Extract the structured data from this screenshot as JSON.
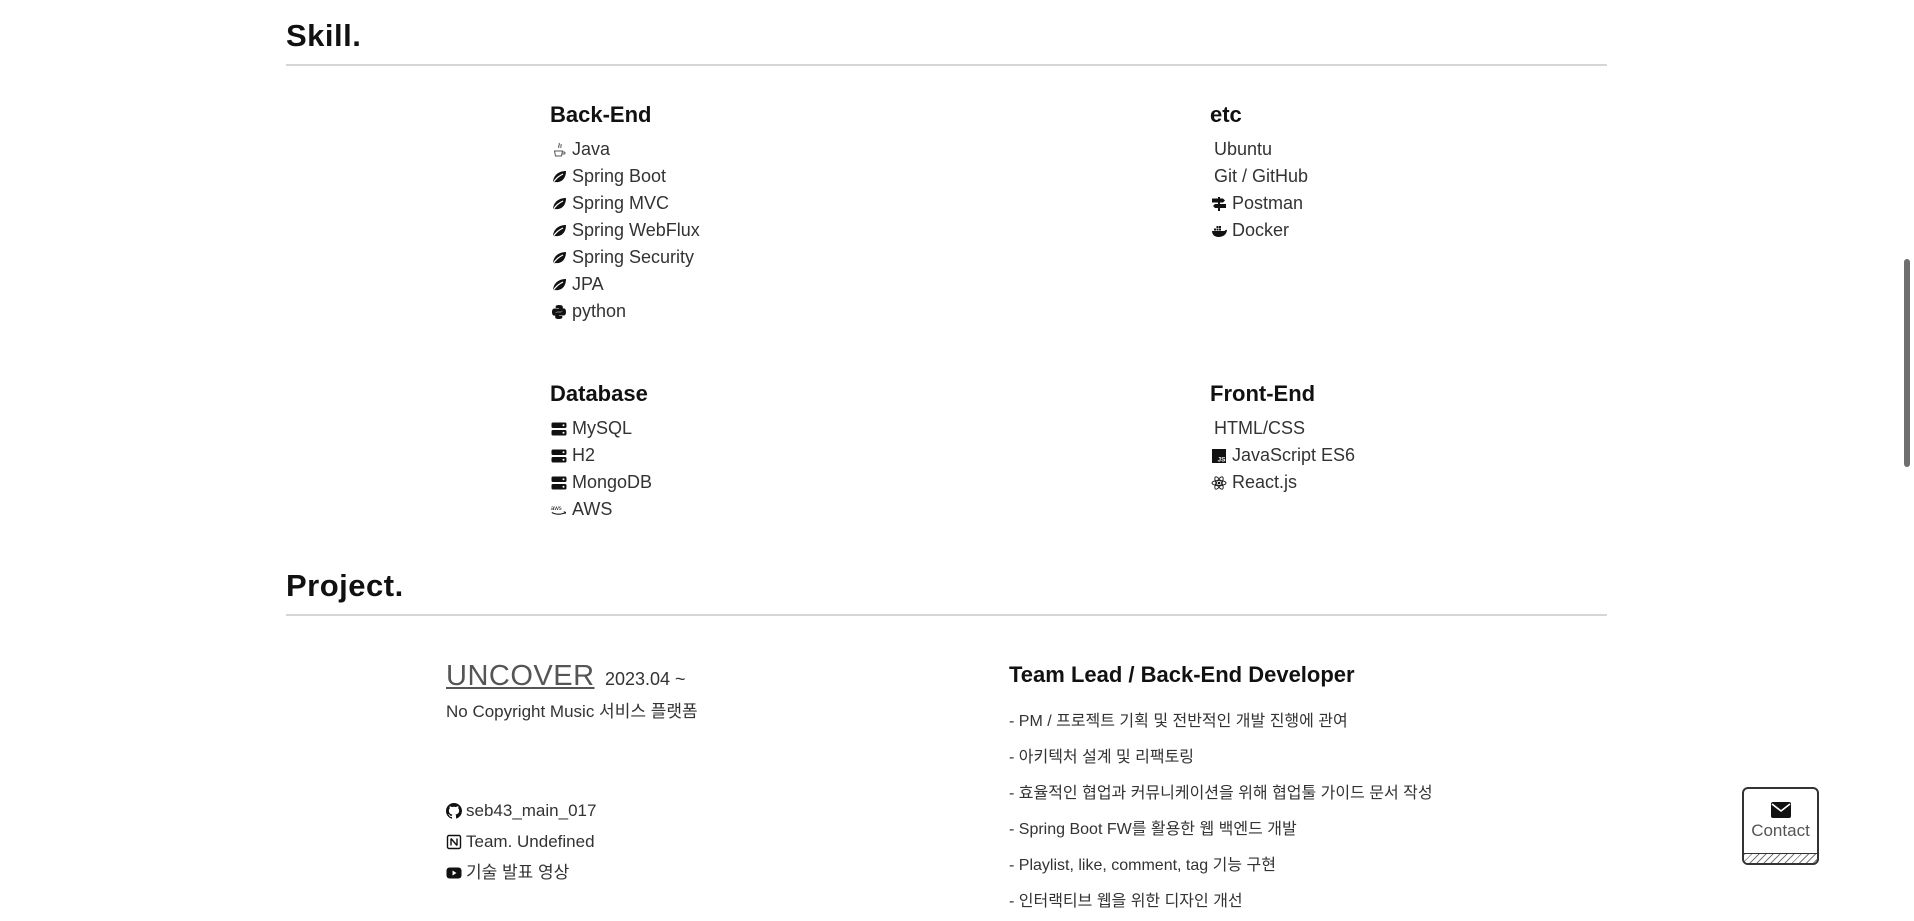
{
  "skill_section": {
    "title": "Skill.",
    "groups": [
      {
        "heading": "Back-End",
        "items": [
          {
            "label": "Java",
            "icon": "java-icon"
          },
          {
            "label": "Spring Boot",
            "icon": "leaf-icon"
          },
          {
            "label": "Spring MVC",
            "icon": "leaf-icon"
          },
          {
            "label": "Spring WebFlux",
            "icon": "leaf-icon"
          },
          {
            "label": "Spring Security",
            "icon": "leaf-icon"
          },
          {
            "label": "JPA",
            "icon": "leaf-icon"
          },
          {
            "label": "python",
            "icon": "python-icon"
          }
        ]
      },
      {
        "heading": "etc",
        "items": [
          {
            "label": "Ubuntu",
            "icon": "none"
          },
          {
            "label": "Git / GitHub",
            "icon": "none"
          },
          {
            "label": "Postman",
            "icon": "signpost-icon"
          },
          {
            "label": "Docker",
            "icon": "docker-icon"
          }
        ]
      },
      {
        "heading": "Database",
        "items": [
          {
            "label": "MySQL",
            "icon": "server-icon"
          },
          {
            "label": "H2",
            "icon": "server-icon"
          },
          {
            "label": "MongoDB",
            "icon": "server-icon"
          },
          {
            "label": "AWS",
            "icon": "aws-icon"
          }
        ]
      },
      {
        "heading": "Front-End",
        "items": [
          {
            "label": "HTML/CSS",
            "icon": "none"
          },
          {
            "label": "JavaScript ES6",
            "icon": "js-icon"
          },
          {
            "label": "React.js",
            "icon": "react-icon"
          }
        ]
      }
    ]
  },
  "project_section": {
    "title": "Project.",
    "project": {
      "name": "UNCOVER",
      "date": "2023.04 ~",
      "description": "No Copyright Music 서비스 플랫폼",
      "links": [
        {
          "label": "seb43_main_017",
          "icon": "github-icon"
        },
        {
          "label": "Team. Undefined",
          "icon": "notion-icon"
        },
        {
          "label": "기술 발표 영상",
          "icon": "youtube-icon"
        }
      ],
      "role": "Team Lead / Back-End Developer",
      "tasks": [
        "- PM / 프로젝트 기획 및 전반적인 개발 진행에 관여",
        "- 아키텍처 설계 및 리팩토링",
        "- 효율적인 협업과 커뮤니케이션을 위해 협업툴 가이드 문서 작성",
        "- Spring Boot FW를 활용한 웹 백엔드 개발",
        "- Playlist, like, comment, tag 기능 구현",
        "- 인터랙티브 웹을 위한 디자인 개선"
      ]
    }
  },
  "contact_button": {
    "label": "Contact",
    "icon": "envelope-icon"
  }
}
